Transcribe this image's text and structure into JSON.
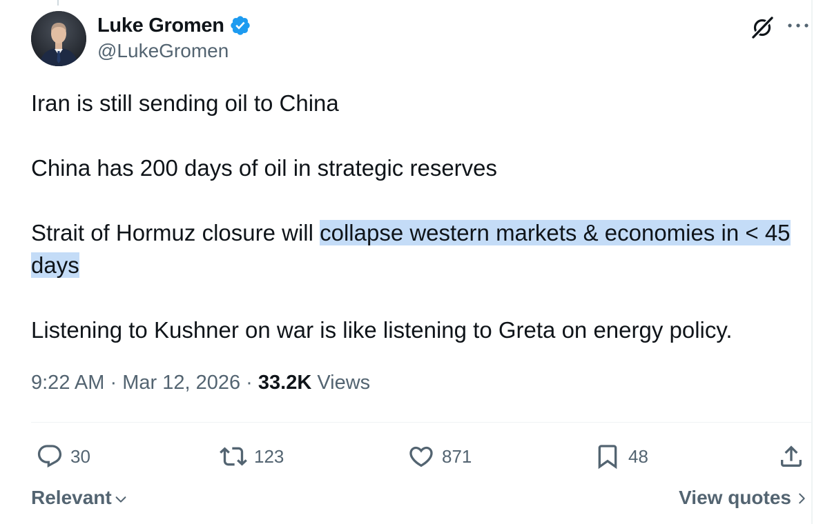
{
  "author": {
    "name": "Luke Gromen",
    "handle": "@LukeGromen"
  },
  "tweet": {
    "paragraphs": [
      "Iran is still sending oil to China",
      "China has 200 days of oil in strategic reserves"
    ],
    "highlight_paragraph": {
      "before": "Strait of Hormuz closure will ",
      "highlighted": "collapse western markets & economies in < 45 days"
    },
    "last_paragraph": "Listening to Kushner on war is like listening to Greta on energy policy."
  },
  "meta": {
    "time": "9:22 AM",
    "separator": "·",
    "date": "Mar 12, 2026",
    "views_count": "33.2K",
    "views_label": "Views"
  },
  "actions": {
    "replies": "30",
    "reposts": "123",
    "likes": "871",
    "bookmarks": "48"
  },
  "footer": {
    "sort_label": "Relevant",
    "view_quotes_label": "View quotes"
  },
  "colors": {
    "text": "#0f1419",
    "secondary": "#536471",
    "verified": "#1d9bf0",
    "highlight": "#c4dcf7"
  },
  "icons": [
    "verified-badge-icon",
    "grok-icon",
    "more-icon",
    "reply-icon",
    "repost-icon",
    "like-icon",
    "bookmark-icon",
    "share-icon",
    "chevron-down-icon",
    "chevron-right-icon"
  ]
}
